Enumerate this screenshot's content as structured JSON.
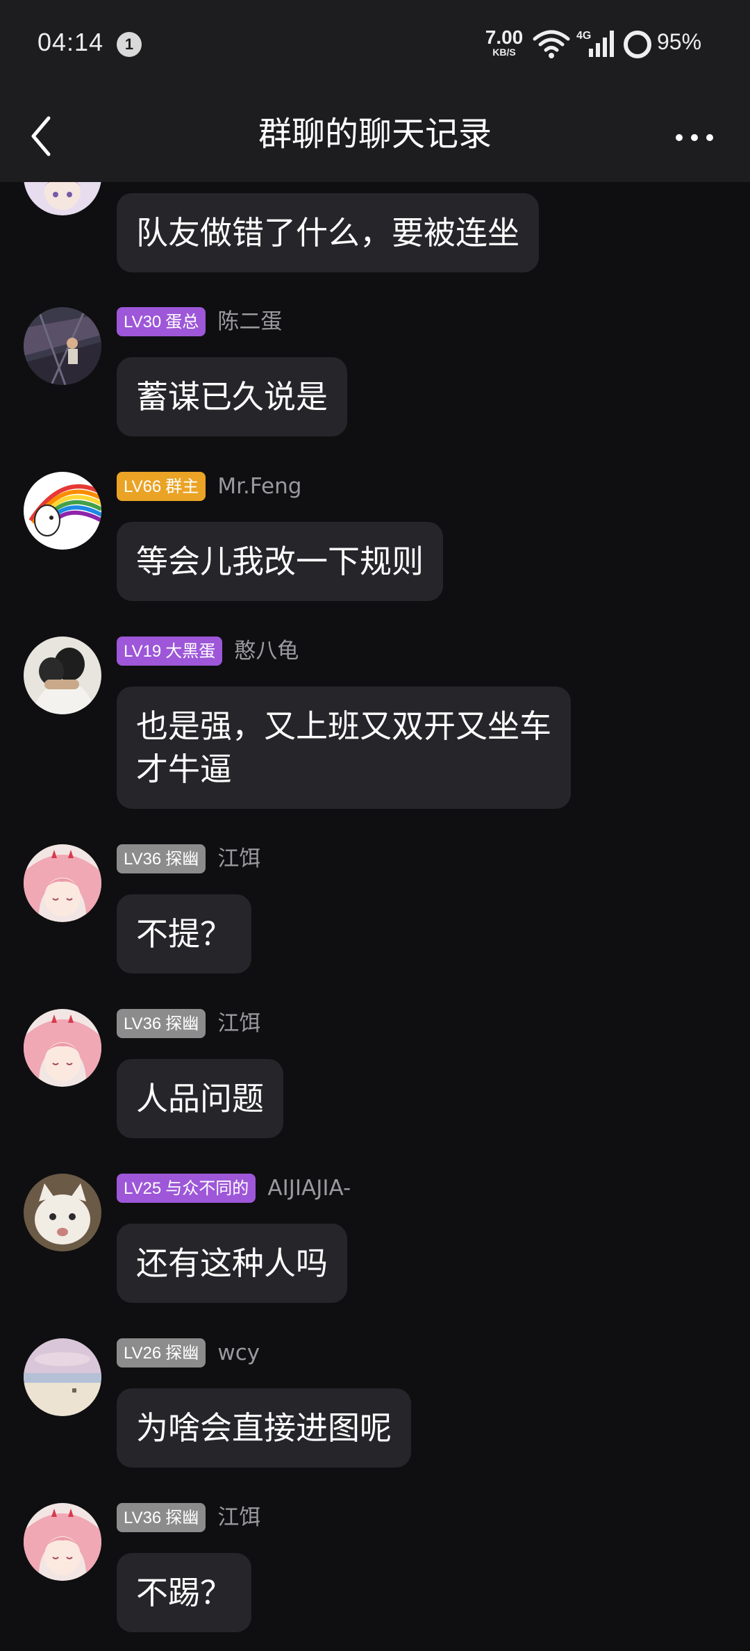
{
  "status_bar": {
    "time": "04:14",
    "notification_count": "1",
    "net_speed_value": "7.00",
    "net_speed_unit": "KB/S",
    "network_type": "4G",
    "battery_percent": "95%"
  },
  "header": {
    "title": "群聊的聊天记录"
  },
  "messages": [
    {
      "avatar": "anime-girl-purple-hair-avatar",
      "level": "",
      "title": "",
      "badge_color": "",
      "name": "",
      "text": "队友做错了什么，要被连坐"
    },
    {
      "avatar": "stormy-sky-photo-avatar",
      "level": "LV30",
      "title": "蛋总",
      "badge_color": "#9d57d8",
      "name": "陈二蛋",
      "text": "蓄谋已久说是"
    },
    {
      "avatar": "rainbow-meme-avatar",
      "level": "LV66",
      "title": "群主",
      "badge_color": "#eaa325",
      "name": "Mr.Feng",
      "text": "等会儿我改一下规则"
    },
    {
      "avatar": "hugging-people-photo-avatar",
      "level": "LV19",
      "title": "大黑蛋",
      "badge_color": "#9d57d8",
      "name": "憨八龟",
      "text": "也是强，又上班又双开又坐车\n才牛逼"
    },
    {
      "avatar": "pink-hair-anime-girl-avatar",
      "level": "LV36",
      "title": "探幽",
      "badge_color": "#8c8c8c",
      "name": "江饵",
      "text": "不提？"
    },
    {
      "avatar": "pink-hair-anime-girl-avatar",
      "level": "LV36",
      "title": "探幽",
      "badge_color": "#8c8c8c",
      "name": "江饵",
      "text": "人品问题"
    },
    {
      "avatar": "white-cat-photo-avatar",
      "level": "LV25",
      "title": "与众不同的",
      "badge_color": "#9d57d8",
      "name": "AIJIAJIA-",
      "text": "还有这种人吗"
    },
    {
      "avatar": "beach-landscape-avatar",
      "level": "LV26",
      "title": "探幽",
      "badge_color": "#8c8c8c",
      "name": "wcy",
      "text": "为啥会直接进图呢"
    },
    {
      "avatar": "pink-hair-anime-girl-avatar",
      "level": "LV36",
      "title": "探幽",
      "badge_color": "#8c8c8c",
      "name": "江饵",
      "text": "不踢？"
    }
  ]
}
